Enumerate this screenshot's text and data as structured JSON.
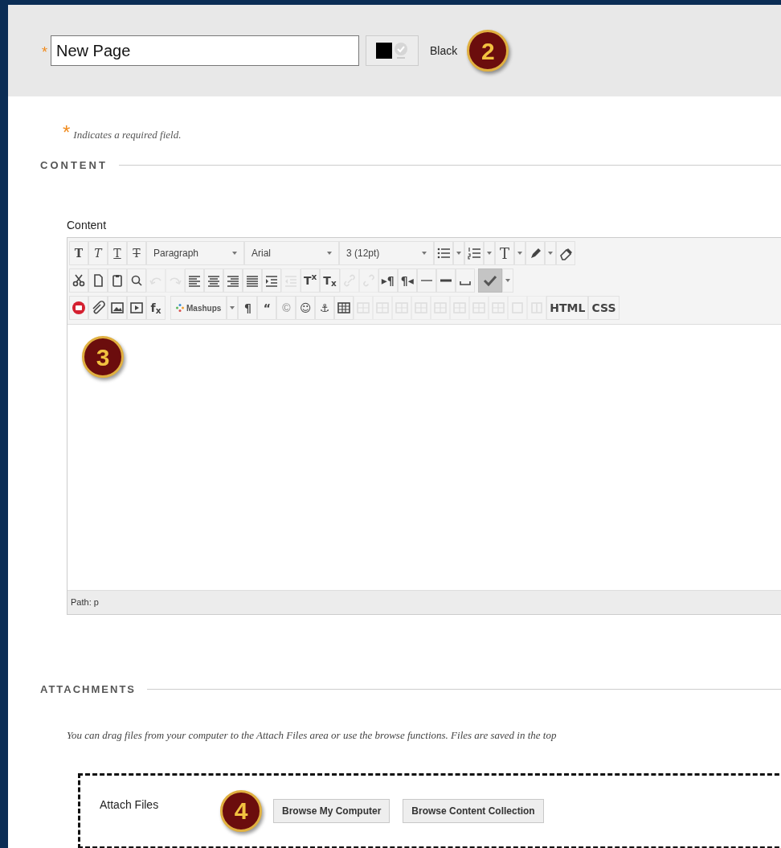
{
  "header": {
    "required_mark": "*",
    "title_value": "New Page",
    "color_label": "Black",
    "callout": "2"
  },
  "required_note": {
    "mark": "*",
    "text": "Indicates a required field."
  },
  "content_section": {
    "heading": "CONTENT",
    "editor_label": "Content",
    "callout": "3",
    "path": "Path: p",
    "toolbar": [
      [
        {
          "kind": "glyph",
          "text": "T",
          "disabled": false
        },
        {
          "kind": "glyph",
          "text": "T",
          "disabled": false
        },
        {
          "kind": "glyph",
          "text": "T",
          "disabled": false
        },
        {
          "kind": "glyph",
          "text": "T",
          "disabled": false
        },
        {
          "kind": "select",
          "text": "Paragraph"
        },
        {
          "kind": "select",
          "text": "Arial"
        },
        {
          "kind": "select",
          "text": "3 (12pt)"
        },
        {
          "kind": "icon",
          "disabled": false
        },
        {
          "kind": "caret"
        },
        {
          "kind": "icon",
          "disabled": false
        },
        {
          "kind": "caret"
        },
        {
          "kind": "glyph",
          "text": "T",
          "disabled": false
        },
        {
          "kind": "caret"
        },
        {
          "kind": "icon",
          "disabled": false
        },
        {
          "kind": "caret"
        },
        {
          "kind": "icon",
          "disabled": false
        }
      ],
      [
        {
          "kind": "icon",
          "disabled": false
        },
        {
          "kind": "icon",
          "disabled": false
        },
        {
          "kind": "icon",
          "disabled": false
        },
        {
          "kind": "icon",
          "disabled": false
        },
        {
          "kind": "icon",
          "disabled": true
        },
        {
          "kind": "icon",
          "disabled": true
        },
        {
          "kind": "icon",
          "disabled": false
        },
        {
          "kind": "icon",
          "disabled": false
        },
        {
          "kind": "icon",
          "disabled": false
        },
        {
          "kind": "icon",
          "disabled": false
        },
        {
          "kind": "icon",
          "disabled": false
        },
        {
          "kind": "icon",
          "disabled": true
        },
        {
          "kind": "glyph",
          "text": "T$^{x}$",
          "disabled": false
        },
        {
          "kind": "glyph",
          "text": "T$_{x}$",
          "disabled": false
        },
        {
          "kind": "icon",
          "disabled": true
        },
        {
          "kind": "icon",
          "disabled": true
        },
        {
          "kind": "glyph",
          "text": "▸¶",
          "disabled": false
        },
        {
          "kind": "glyph",
          "text": "¶◂",
          "disabled": false
        },
        {
          "kind": "icon",
          "disabled": false
        },
        {
          "kind": "icon",
          "disabled": false
        },
        {
          "kind": "icon",
          "disabled": false
        },
        {
          "kind": "toggle",
          "on": true
        },
        {
          "kind": "caret"
        }
      ],
      [
        {
          "kind": "icon",
          "disabled": false
        },
        {
          "kind": "icon",
          "disabled": false
        },
        {
          "kind": "icon",
          "disabled": false
        },
        {
          "kind": "icon",
          "disabled": false
        },
        {
          "kind": "glyph",
          "text": "f$_{x}$",
          "disabled": false
        },
        {
          "kind": "mashups",
          "text": "Mashups"
        },
        {
          "kind": "caret"
        },
        {
          "kind": "glyph",
          "text": "¶",
          "disabled": false
        },
        {
          "kind": "glyph",
          "text": "“",
          "disabled": false
        },
        {
          "kind": "glyph",
          "text": "©",
          "disabled": true
        },
        {
          "kind": "glyph",
          "text": "☺",
          "disabled": false
        },
        {
          "kind": "glyph",
          "text": "⚓",
          "disabled": false
        },
        {
          "kind": "icon",
          "disabled": false
        },
        {
          "kind": "icon",
          "disabled": true
        },
        {
          "kind": "icon",
          "disabled": true
        },
        {
          "kind": "icon",
          "disabled": true
        },
        {
          "kind": "icon",
          "disabled": true
        },
        {
          "kind": "icon",
          "disabled": true
        },
        {
          "kind": "icon",
          "disabled": true
        },
        {
          "kind": "icon",
          "disabled": true
        },
        {
          "kind": "icon",
          "disabled": true
        },
        {
          "kind": "icon",
          "disabled": true
        },
        {
          "kind": "icon",
          "disabled": true
        },
        {
          "kind": "glyph",
          "text": "HTML",
          "disabled": false
        },
        {
          "kind": "glyph",
          "text": "CSS",
          "disabled": false
        }
      ]
    ]
  },
  "attachments": {
    "heading": "ATTACHMENTS",
    "note": "You can drag files from your computer to the Attach Files area or use the browse functions. Files are saved in the top",
    "label": "Attach Files",
    "callout": "4",
    "buttons": [
      "Browse My Computer",
      "Browse Content Collection"
    ]
  }
}
